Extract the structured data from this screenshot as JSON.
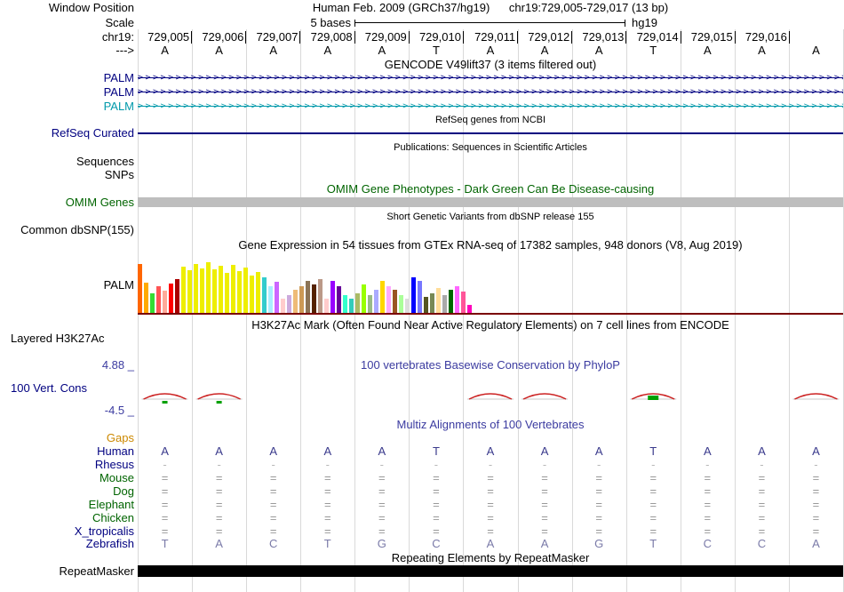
{
  "colors": {
    "navy": "#000080",
    "teal": "#0099AA",
    "dark_green": "#006400",
    "title_blue": "#3B3BA0",
    "gaps_orange": "#CC8800",
    "grid": "#D9D9D9",
    "omim_bar": "#BEBEBE",
    "gtex_baseline": "#7A0000",
    "conservation_red": "#CC2222",
    "conservation_green": "#00A000"
  },
  "header": {
    "window_position_label": "Window Position",
    "assembly_title": "Human Feb. 2009 (GRCh37/hg19)",
    "range_title": "chr19:729,005-729,017 (13 bp)",
    "scale_label": "Scale",
    "scale_bar_text": "5 bases",
    "assembly_short": "hg19",
    "chrom_label": "chr19:",
    "position_ticks": [
      "729,005",
      "729,006",
      "729,007",
      "729,008",
      "729,009",
      "729,010",
      "729,011",
      "729,012",
      "729,013",
      "729,014",
      "729,015",
      "729,016"
    ],
    "strand_label": "--->",
    "bases": [
      "A",
      "A",
      "A",
      "A",
      "A",
      "T",
      "A",
      "A",
      "A",
      "T",
      "A",
      "A",
      "A"
    ]
  },
  "gencode": {
    "title": "GENCODE V49lift37 (3 items filtered out)",
    "arrow_char": ">",
    "transcripts": [
      {
        "label": "PALM",
        "color": "#000080"
      },
      {
        "label": "PALM",
        "color": "#000080"
      },
      {
        "label": "PALM",
        "color": "#0099AA"
      }
    ]
  },
  "refseq": {
    "title": "RefSeq genes from NCBI",
    "label": "RefSeq Curated"
  },
  "publications": {
    "title": "Publications: Sequences in Scientific Articles",
    "sequences_label": "Sequences",
    "snps_label": "SNPs"
  },
  "omim": {
    "title": "OMIM Gene Phenotypes - Dark Green Can Be Disease-causing",
    "label": "OMIM Genes"
  },
  "dbsnp": {
    "title": "Short Genetic Variants from dbSNP release 155",
    "label": "Common dbSNP(155)"
  },
  "gtex": {
    "title": "Gene Expression in 54 tissues from GTEx RNA-seq of 17382 samples, 948 donors (V8, Aug 2019)",
    "label": "PALM",
    "bars": [
      {
        "h": 55,
        "c": "#FF6600"
      },
      {
        "h": 34,
        "c": "#FFAA00"
      },
      {
        "h": 22,
        "c": "#33DD33"
      },
      {
        "h": 30,
        "c": "#FF5555"
      },
      {
        "h": 25,
        "c": "#FFAA99"
      },
      {
        "h": 33,
        "c": "#FF0000"
      },
      {
        "h": 38,
        "c": "#AA0000"
      },
      {
        "h": 52,
        "c": "#EEEE00"
      },
      {
        "h": 48,
        "c": "#EEEE00"
      },
      {
        "h": 55,
        "c": "#EEEE00"
      },
      {
        "h": 50,
        "c": "#EEEE00"
      },
      {
        "h": 57,
        "c": "#EEEE00"
      },
      {
        "h": 49,
        "c": "#EEEE00"
      },
      {
        "h": 53,
        "c": "#EEEE00"
      },
      {
        "h": 45,
        "c": "#EEEE00"
      },
      {
        "h": 54,
        "c": "#EEEE00"
      },
      {
        "h": 47,
        "c": "#EEEE00"
      },
      {
        "h": 51,
        "c": "#EEEE00"
      },
      {
        "h": 42,
        "c": "#EEEE00"
      },
      {
        "h": 46,
        "c": "#EEEE00"
      },
      {
        "h": 40,
        "c": "#33CCCC"
      },
      {
        "h": 30,
        "c": "#AAEEFF"
      },
      {
        "h": 35,
        "c": "#CC66FF"
      },
      {
        "h": 16,
        "c": "#FFCCCC"
      },
      {
        "h": 20,
        "c": "#CCAADD"
      },
      {
        "h": 26,
        "c": "#EEBB77"
      },
      {
        "h": 30,
        "c": "#CC9955"
      },
      {
        "h": 36,
        "c": "#8B7355"
      },
      {
        "h": 32,
        "c": "#552200"
      },
      {
        "h": 38,
        "c": "#BB9988"
      },
      {
        "h": 16,
        "c": "#FFCCCC"
      },
      {
        "h": 36,
        "c": "#9900FF"
      },
      {
        "h": 30,
        "c": "#660099"
      },
      {
        "h": 20,
        "c": "#33FFCC"
      },
      {
        "h": 16,
        "c": "#33CCBB"
      },
      {
        "h": 22,
        "c": "#AABB66"
      },
      {
        "h": 32,
        "c": "#99FF00"
      },
      {
        "h": 20,
        "c": "#99BB88"
      },
      {
        "h": 26,
        "c": "#AAAAFF"
      },
      {
        "h": 36,
        "c": "#FFD700"
      },
      {
        "h": 30,
        "c": "#FFAAFF"
      },
      {
        "h": 26,
        "c": "#995522"
      },
      {
        "h": 20,
        "c": "#AAFF99"
      },
      {
        "h": 16,
        "c": "#DDDDDD"
      },
      {
        "h": 40,
        "c": "#0000FF"
      },
      {
        "h": 36,
        "c": "#7777FF"
      },
      {
        "h": 18,
        "c": "#555522"
      },
      {
        "h": 22,
        "c": "#778855"
      },
      {
        "h": 28,
        "c": "#FFDD99"
      },
      {
        "h": 20,
        "c": "#AAAAAA"
      },
      {
        "h": 26,
        "c": "#006600"
      },
      {
        "h": 30,
        "c": "#FF66FF"
      },
      {
        "h": 24,
        "c": "#FF5599"
      },
      {
        "h": 9,
        "c": "#FF00BB"
      }
    ]
  },
  "h3k27ac": {
    "title": "H3K27Ac Mark (Often Found Near Active Regulatory Elements) on 7 cell lines from ENCODE",
    "label": "Layered H3K27Ac"
  },
  "conservation": {
    "title": "100 vertebrates Basewise Conservation by PhyloP",
    "label": "100 Vert. Cons",
    "max_label": "4.88 _",
    "min_label": "-4.5 _",
    "peaks": [
      {
        "col": 0,
        "green_below": true
      },
      {
        "col": 1,
        "green_below": true
      },
      {
        "col": 6
      },
      {
        "col": 7
      },
      {
        "col": 9,
        "green_center": true
      },
      {
        "col": 12
      }
    ]
  },
  "multiz": {
    "title": "Multiz Alignments of 100 Vertebrates",
    "rows": [
      {
        "label": "Gaps",
        "label_color": "#CC8800",
        "cell_color": "#888888",
        "cells": [
          "",
          "",
          "",
          "",
          "",
          "",
          "",
          "",
          "",
          "",
          "",
          "",
          ""
        ]
      },
      {
        "label": "Human",
        "label_color": "#000080",
        "cell_color": "#3A3A8C",
        "cells": [
          "A",
          "A",
          "A",
          "A",
          "A",
          "T",
          "A",
          "A",
          "A",
          "T",
          "A",
          "A",
          "A"
        ]
      },
      {
        "label": "Rhesus",
        "label_color": "#000080",
        "cell_color": "#B8B8B8",
        "cells": [
          "-",
          "-",
          "-",
          "-",
          "-",
          "-",
          "-",
          "-",
          "-",
          "-",
          "-",
          "-",
          "-"
        ]
      },
      {
        "label": "Mouse",
        "label_color": "#006400",
        "cell_color": "#999999",
        "cells": [
          "=",
          "=",
          "=",
          "=",
          "=",
          "=",
          "=",
          "=",
          "=",
          "=",
          "=",
          "=",
          "="
        ]
      },
      {
        "label": "Dog",
        "label_color": "#006400",
        "cell_color": "#999999",
        "cells": [
          "=",
          "=",
          "=",
          "=",
          "=",
          "=",
          "=",
          "=",
          "=",
          "=",
          "=",
          "=",
          "="
        ]
      },
      {
        "label": "Elephant",
        "label_color": "#006400",
        "cell_color": "#999999",
        "cells": [
          "=",
          "=",
          "=",
          "=",
          "=",
          "=",
          "=",
          "=",
          "=",
          "=",
          "=",
          "=",
          "="
        ]
      },
      {
        "label": "Chicken",
        "label_color": "#006400",
        "cell_color": "#999999",
        "cells": [
          "=",
          "=",
          "=",
          "=",
          "=",
          "=",
          "=",
          "=",
          "=",
          "=",
          "=",
          "=",
          "="
        ]
      },
      {
        "label": "X_tropicalis",
        "label_color": "#000080",
        "cell_color": "#999999",
        "cells": [
          "=",
          "=",
          "=",
          "=",
          "=",
          "=",
          "=",
          "=",
          "=",
          "=",
          "=",
          "=",
          "="
        ]
      },
      {
        "label": "Zebrafish",
        "label_color": "#000080",
        "cell_color": "#7A7AA8",
        "cells": [
          "T",
          "A",
          "C",
          "T",
          "G",
          "C",
          "A",
          "A",
          "G",
          "T",
          "C",
          "C",
          "A"
        ]
      }
    ]
  },
  "repeatmasker": {
    "title": "Repeating Elements by RepeatMasker",
    "label": "RepeatMasker"
  }
}
